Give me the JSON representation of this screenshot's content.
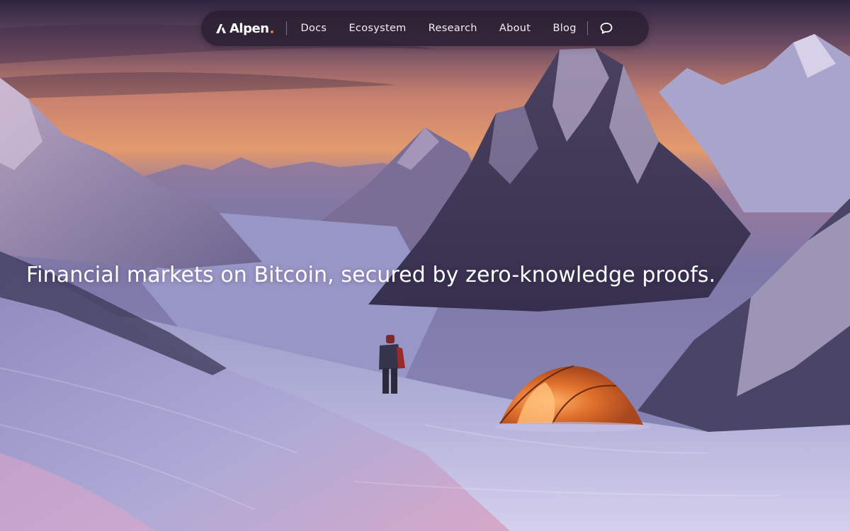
{
  "nav": {
    "logo_text": "Alpen",
    "links": [
      {
        "label": "Docs"
      },
      {
        "label": "Ecosystem"
      },
      {
        "label": "Research"
      },
      {
        "label": "About"
      },
      {
        "label": "Blog"
      }
    ],
    "chat_icon": "chat-bubble-icon"
  },
  "hero": {
    "headline": "Financial markets on Bitcoin, secured by zero-knowledge proofs."
  },
  "colors": {
    "nav_background": "#281e30",
    "logo_accent": "#e8743a",
    "text": "#ffffff",
    "tent": "#d8662a"
  }
}
